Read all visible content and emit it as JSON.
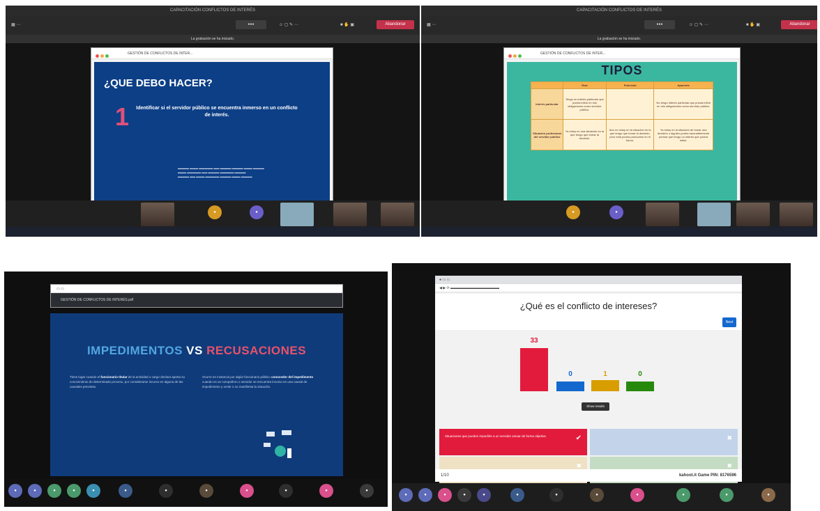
{
  "panel1": {
    "title": "CAPACITACIÓN CONFLICTOS DE INTERÉS",
    "leave": "Abandonar",
    "record_notice": "La grabación se ha iniciado.",
    "doc_title": "GESTIÓN DE CONFLICTOS DE INTER...",
    "slide_title": "¿QUE DEBO HACER?",
    "slide_number": "1",
    "slide_text": "Identificar si el servidor público se encuentra inmerso en un conflicto de interés."
  },
  "panel2": {
    "title": "CAPACITACIÓN CONFLICTOS DE INTERÉS",
    "leave": "Abandonar",
    "record_notice": "La grabación se ha iniciado.",
    "doc_title": "GESTIÓN DE CONFLICTOS DE INTER...",
    "slide_title": "TIPOS",
    "table_headers": [
      "",
      "Real",
      "Potencial",
      "Aparente"
    ],
    "row1_header": "Interés particular",
    "row2_header": "Situación profesional del servidor público",
    "row1_cells": [
      "Tengo un interés particular que podría influir en mis obligaciones como servidor público.",
      "",
      "No tengo interés particular que pueda influir en mis obligaciones como servidor público."
    ],
    "row2_cells": [
      "Ya estoy en una situación en la que tengo que tomar la decisión.",
      "Aún no estoy en la situación en la que tengo que tomar la decisión, pero esta podría producirse en el futuro.",
      "Ya estoy en la situación de tomar una decisión o alguien podría razonablemente pensar que tengo un interés que podría influir."
    ]
  },
  "panel3": {
    "doc_title": "GESTIÓN DE CONFLICTOS DE INTERÉS.pdf",
    "title_part1": "IMPEDIMENTOS",
    "title_part2": "VS",
    "title_part3": "RECUSACIONES",
    "col1_lead": "Tiene lugar cuando el",
    "col1_bold": "funcionario titular",
    "col1_rest": "de la actividad o cargo declara aparta su conocimiento de determinado proceso, por considerarse incurso en alguna de las causales previstas.",
    "col2_lead": "Ocurre en instancia por algún funcionario público",
    "col2_bold": "conocedor del impedimento",
    "col2_rest": "cuando es un compañero o servidor se encuentra incurso en una causal de impedimento y omite o no manifiesta la situación."
  },
  "panel4": {
    "question": "¿Qué es el conflicto de intereses?",
    "next": "Next",
    "show_results": "Show results",
    "counts": [
      "33",
      "0",
      "1",
      "0"
    ],
    "answer1": "Situaciones que pueden impedirle a un servidor actuar de forma objetiva",
    "footer_left": "1/10",
    "footer_right": "kahoot.it   Game PIN: 8176596",
    "colors": {
      "red": "#e21b3c",
      "blue": "#1368ce",
      "yellow": "#d89e00",
      "green": "#26890c"
    }
  }
}
